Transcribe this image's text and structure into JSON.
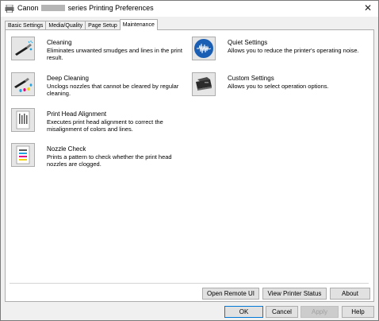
{
  "window": {
    "title_prefix": "Canon",
    "title_suffix": "series Printing Preferences",
    "close_glyph": "✕"
  },
  "tabs": [
    {
      "label": "Basic Settings"
    },
    {
      "label": "Media/Quality"
    },
    {
      "label": "Page Setup"
    },
    {
      "label": "Maintenance",
      "active": true
    }
  ],
  "maintenance": {
    "left": [
      {
        "title": "Cleaning",
        "description": "Eliminates unwanted smudges and lines in the print result.",
        "icon": "cleaning-icon"
      },
      {
        "title": "Deep Cleaning",
        "description": "Unclogs nozzles that cannot be cleared by regular cleaning.",
        "icon": "deep-cleaning-icon"
      },
      {
        "title": "Print Head Alignment",
        "description": "Executes print head alignment to correct the misalignment of colors and lines.",
        "icon": "alignment-icon"
      },
      {
        "title": "Nozzle Check",
        "description": "Prints a pattern to check whether the print head nozzles are clogged.",
        "icon": "nozzle-check-icon"
      }
    ],
    "right": [
      {
        "title": "Quiet Settings",
        "description": "Allows you to reduce the printer's operating noise.",
        "icon": "quiet-icon"
      },
      {
        "title": "Custom Settings",
        "description": "Allows you to select operation options.",
        "icon": "printer-icon"
      }
    ]
  },
  "panel_buttons": {
    "open_remote_ui": "Open Remote UI",
    "view_printer_status": "View Printer Status",
    "about": "About"
  },
  "dialog_buttons": {
    "ok": "OK",
    "cancel": "Cancel",
    "apply": "Apply",
    "help": "Help"
  }
}
